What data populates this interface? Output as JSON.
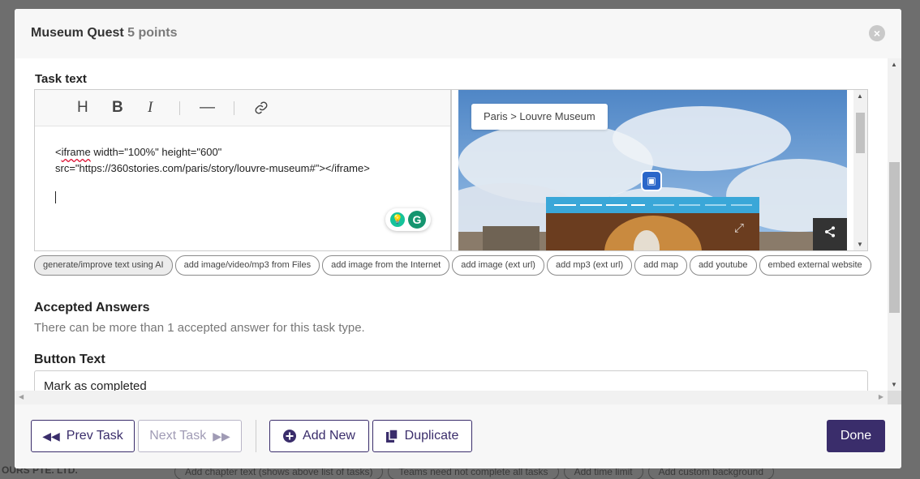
{
  "modal": {
    "title": "Museum Quest",
    "points": "5 points",
    "close_icon": "×"
  },
  "task_text": {
    "label": "Task text",
    "toolbar": {
      "heading": "H",
      "bold": "B",
      "italic": "I",
      "hr": "—",
      "link": "🔗"
    },
    "content_line1_tag": "iframe",
    "content_line1_prefix": "<",
    "content_line1_rest": " width=\"100%\" height=\"600\"",
    "content_line2": "src=\"https://360stories.com/paris/story/louvre-museum#\"></iframe>"
  },
  "preview": {
    "breadcrumb": "Paris  >  Louvre Museum"
  },
  "chips": [
    "generate/improve text using AI",
    "add image/video/mp3 from Files",
    "add image from the Internet",
    "add image (ext url)",
    "add mp3 (ext url)",
    "add map",
    "add youtube",
    "embed external website"
  ],
  "accepted_answers": {
    "title": "Accepted Answers",
    "description": "There can be more than 1 accepted answer for this task type."
  },
  "button_text": {
    "title": "Button Text",
    "value": "Mark as completed"
  },
  "footer": {
    "prev_task": "Prev Task",
    "next_task": "Next Task",
    "add_new": "Add New",
    "duplicate": "Duplicate",
    "done": "Done"
  },
  "background": {
    "company": "OURS PTE. LTD.",
    "chips": [
      "Add chapter text (shows above list of tasks)",
      "Teams need not complete all tasks",
      "Add time limit",
      "Add custom background"
    ]
  },
  "colors": {
    "accent": "#3a2d6b",
    "grammarly": "#15c39a"
  }
}
